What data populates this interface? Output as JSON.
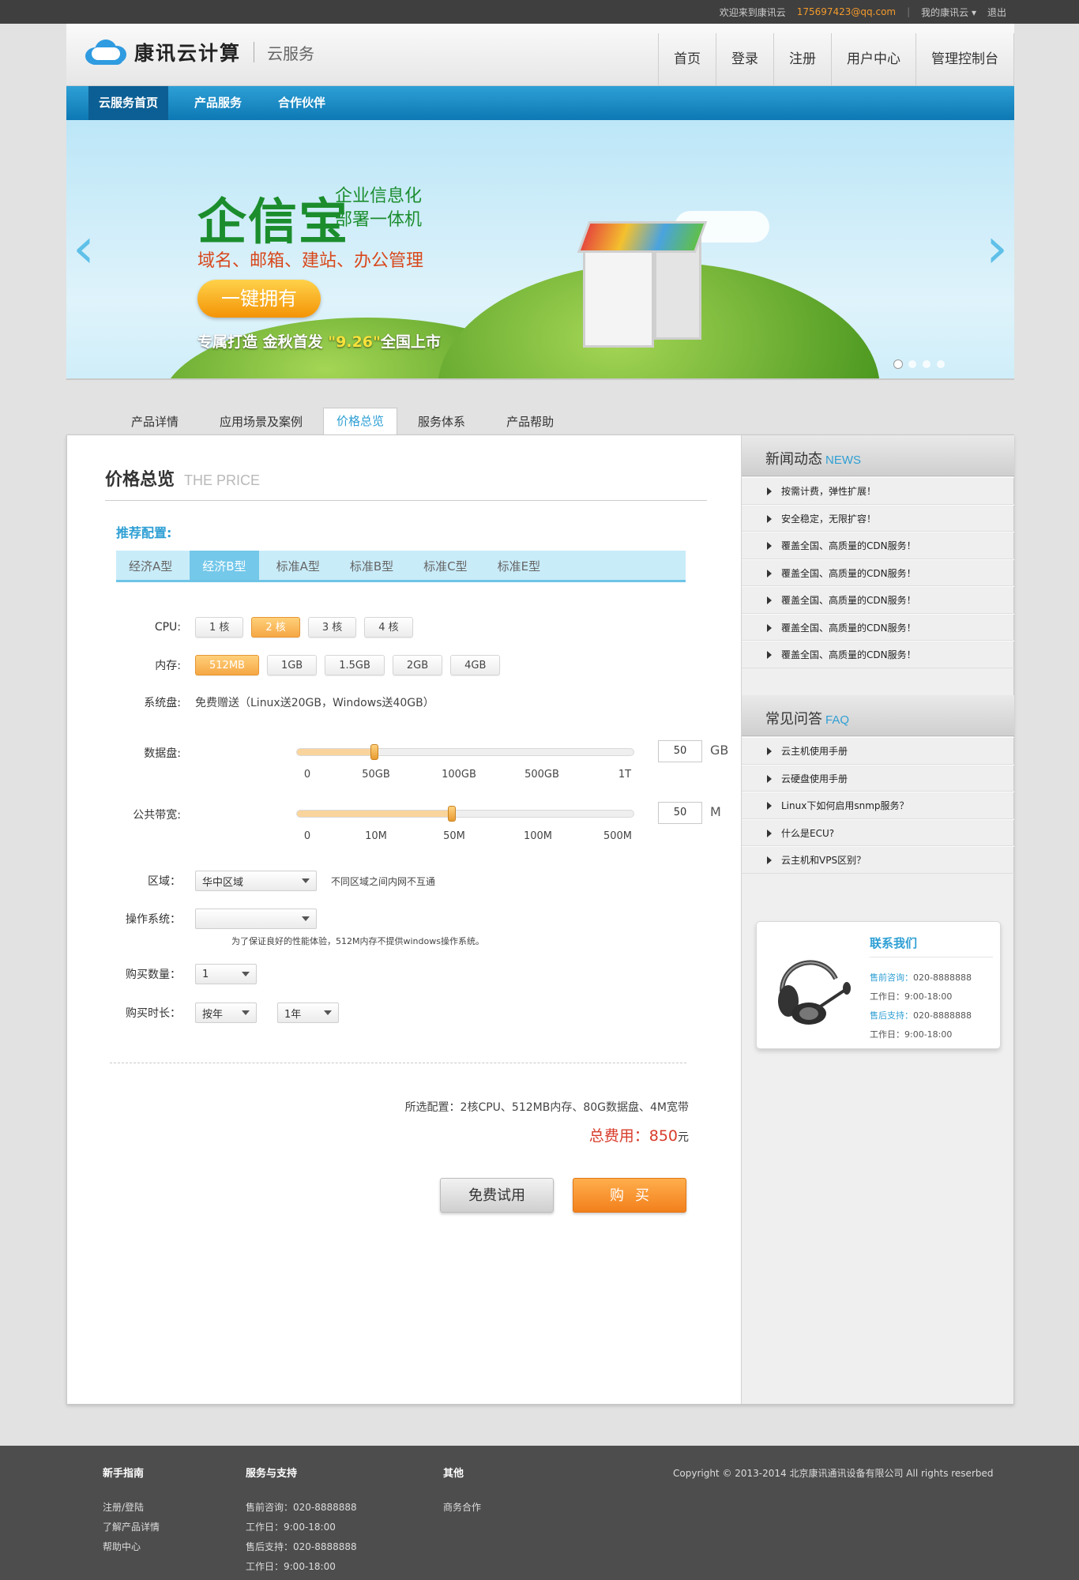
{
  "topbar": {
    "welcome": "欢迎来到康讯云",
    "email": "175697423@qq.com",
    "my_cloud": "我的康讯云 ▾",
    "logout": "退出"
  },
  "header": {
    "brand": "康讯云计算",
    "sub": "云服务",
    "nav": [
      "首页",
      "登录",
      "注册",
      "用户中心",
      "管理控制台"
    ]
  },
  "subnav": [
    "云服务首页",
    "产品服务",
    "合作伙伴"
  ],
  "banner": {
    "title": "企信宝",
    "title_side": [
      "企业信息化",
      "部署一体机"
    ],
    "line": "域名、邮箱、建站、办公管理",
    "button": "一键拥有",
    "foot_a": "专属打造  金秋首发  ",
    "foot_b": "\"9.26\"",
    "foot_c": "全国上市",
    "prev": "‹",
    "next": "›"
  },
  "tabs": [
    "产品详情",
    "应用场景及案例",
    "价格总览",
    "服务体系",
    "产品帮助"
  ],
  "price": {
    "title": "价格总览",
    "title_en": "THE PRICE",
    "recommend": "推荐配置:",
    "models": [
      "经济A型",
      "经济B型",
      "标准A型",
      "标准B型",
      "标准C型",
      "标准E型"
    ],
    "cpu_label": "CPU:",
    "cpu": [
      "1 核",
      "2 核",
      "3 核",
      "4 核"
    ],
    "mem_label": "内存:",
    "mem": [
      "512MB",
      "1GB",
      "1.5GB",
      "2GB",
      "4GB"
    ],
    "sysdisk_label": "系统盘:",
    "sysdisk": "免费赠送（Linux送20GB，Windows送40GB）",
    "datadisk_label": "数据盘:",
    "datadisk_ticks": [
      "0",
      "50GB",
      "100GB",
      "500GB",
      "1T"
    ],
    "datadisk_value": "50",
    "datadisk_unit": "GB",
    "datadisk_fraction": 0.23,
    "bw_label": "公共带宽:",
    "bw_ticks": [
      "0",
      "10M",
      "50M",
      "100M",
      "500M"
    ],
    "bw_value": "50",
    "bw_unit": "M",
    "bw_fraction": 0.46,
    "region_label": "区域：",
    "region": "华中区域",
    "region_note": "不同区域之间内网不互通",
    "os_label": "操作系统：",
    "os": "",
    "os_note": "为了保证良好的性能体验，512M内存不提供windows操作系统。",
    "qty_label": "购买数量：",
    "qty": "1",
    "dur_label": "购买时长：",
    "dur_unit": "按年",
    "dur": "1年",
    "summary": "所选配置：2核CPU、512MB内存、80G数据盘、4M宽带",
    "total_label": "总费用：",
    "total": "850",
    "total_unit": "元",
    "trial": "免费试用",
    "buy": "购买"
  },
  "news": {
    "title": "新闻动态",
    "title_en": "NEWS",
    "items": [
      "按需计费，弹性扩展！",
      "安全稳定，无限扩容！",
      "覆盖全国、高质量的CDN服务！",
      "覆盖全国、高质量的CDN服务！",
      "覆盖全国、高质量的CDN服务！",
      "覆盖全国、高质量的CDN服务！",
      "覆盖全国、高质量的CDN服务！"
    ]
  },
  "faq": {
    "title": "常见问答",
    "title_en": "FAQ",
    "items": [
      "云主机使用手册",
      "云硬盘使用手册",
      "Linux下如何启用snmp服务？",
      "什么是ECU?",
      "云主机和VPS区别？"
    ]
  },
  "contact": {
    "title": "联系我们",
    "pre_label": "售前咨询：",
    "pre_phone": "020-8888888",
    "pre_hours": "工作日：9:00-18:00",
    "post_label": "售后支持：",
    "post_phone": "020-8888888",
    "post_hours": "工作日：9:00-18:00"
  },
  "footer": {
    "guide_title": "新手指南",
    "guide": [
      "注册/登陆",
      "了解产品详情",
      "帮助中心"
    ],
    "support_title": "服务与支持",
    "support": [
      "售前咨询：020-8888888",
      "工作日：9:00-18:00",
      "售后支持：020-8888888",
      "工作日：9:00-18:00"
    ],
    "other_title": "其他",
    "other": [
      "商务合作"
    ],
    "copyright": "Copyright © 2013-2014  北京康讯通讯设备有限公司  All rights reserbed"
  },
  "colors": {
    "accent": "#2e9fd4",
    "orange": "#f49306",
    "nav_blue": "#0d78b4"
  }
}
